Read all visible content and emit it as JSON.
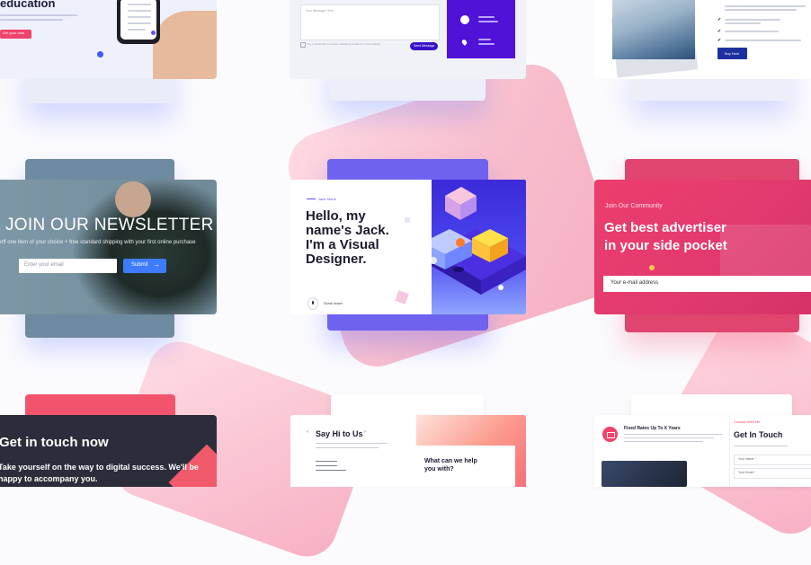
{
  "colors": {
    "accent_blue": "#3d5afe",
    "accent_pink": "#f0436b",
    "purple_dark": "#3a12c9",
    "purple_mid": "#5b1cf0",
    "magenta": "#e23a6e",
    "coral": "#f05a5a",
    "dark_card": "#2b2d3a",
    "green_bg": "#7d97a6"
  },
  "card_education": {
    "heading": "education",
    "cta_label": "Get your card",
    "icons": [
      "phone-icon"
    ]
  },
  "card_contact_form": {
    "message_placeholder": "Your Message Here",
    "checkbox_text": "Yes, I would like to receive marketing emails from this website",
    "submit_label": "Send Message",
    "icons": [
      "phone-icon",
      "location-pin-icon"
    ]
  },
  "card_team": {
    "button_label": "Buy Now",
    "icons": [
      "check-icon"
    ]
  },
  "card_newsletter": {
    "heading": "JOIN OUR NEWSLETTER",
    "subtext": "off one item of your choice + free standard shipping with your first online purchase",
    "email_placeholder": "Enter your email",
    "submit_label": "Submit",
    "icons": [
      "arrow-right-icon"
    ]
  },
  "card_portfolio": {
    "tag": "Jack Stone",
    "headline": [
      "Hello, my",
      "name's Jack.",
      "I'm a Visual",
      "Designer."
    ],
    "scroll_label": "Scroll down",
    "icons": [
      "scroll-mouse-icon"
    ]
  },
  "card_advertiser": {
    "kicker": "Join Our Community",
    "headline": [
      "Get best advertiser",
      "in your side pocket"
    ],
    "email_placeholder": "Your e-mail address",
    "icons": [
      "info-icon"
    ]
  },
  "card_get_in_touch_dark": {
    "heading": "Get in touch now",
    "subtext": [
      "Take yourself on the way to digital success. We'll be",
      "happy to accompany you."
    ]
  },
  "card_say_hi": {
    "heading": "Say Hi to Us",
    "question": [
      "What can we help",
      "you with?"
    ],
    "icons": [
      "chevron-left-icon",
      "chevron-right-icon"
    ]
  },
  "card_fixed_rates": {
    "title": "Fixed Rates Up To X Years",
    "contact_kicker": "Contact With Me",
    "contact_heading": "Get In Touch",
    "name_placeholder": "Your Name *",
    "email_placeholder": "Your Email *",
    "icons": [
      "video-icon"
    ]
  }
}
